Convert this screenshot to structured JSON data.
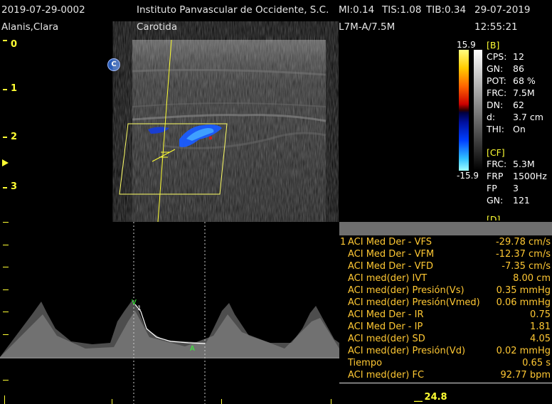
{
  "header": {
    "study_id": "2019-07-29-0002",
    "institution": "Instituto Panvascular de Occidente, S.C.",
    "mi": "MI:0.14",
    "tis": "TIS:1.08",
    "tib": "TIB:0.34",
    "date": "29-07-2019",
    "patient": "Alanis,Clara",
    "exam": "Carotida",
    "probe": "L7M-A/7.5M",
    "time": "12:55:21"
  },
  "depth_scale": [
    "0",
    "1",
    "2",
    "3"
  ],
  "colorbar": {
    "max": "15.9",
    "min": "-15.9"
  },
  "b_mode": {
    "title": "[B]",
    "params": [
      {
        "key": "CPS:",
        "value": "12"
      },
      {
        "key": "GN:",
        "value": "86"
      },
      {
        "key": "POT:",
        "value": "68 %"
      },
      {
        "key": "FRC:",
        "value": "7.5M"
      },
      {
        "key": "DN:",
        "value": "62"
      },
      {
        "key": "d:",
        "value": "3.7 cm"
      },
      {
        "key": "THI:",
        "value": "On"
      }
    ]
  },
  "cf_mode": {
    "title": "[CF]",
    "params": [
      {
        "key": "FRC:",
        "value": "5.3M"
      },
      {
        "key": "FRP",
        "value": "1500Hz"
      },
      {
        "key": "FP",
        "value": "3"
      },
      {
        "key": "GN:",
        "value": "121"
      }
    ],
    "next_section": "[D]"
  },
  "measurements": {
    "index": "1",
    "rows": [
      {
        "label": "ACI Med Der - VFS",
        "value": "-29.78 cm/s"
      },
      {
        "label": "ACI Med Der - VFM",
        "value": "-12.37 cm/s"
      },
      {
        "label": "ACI Med Der - VFD",
        "value": "-7.35 cm/s"
      },
      {
        "label": "ACI med(der) IVT",
        "value": "8.00 cm"
      },
      {
        "label": "ACI med(der) Presión(Vs)",
        "value": "0.35 mmHg"
      },
      {
        "label": "ACI med(der) Presión(Vmed)",
        "value": "0.06 mmHg"
      },
      {
        "label": "ACI Med Der - IR",
        "value": "0.75"
      },
      {
        "label": "ACI Med Der - IP",
        "value": "1.81"
      },
      {
        "label": "ACI med(der) SD",
        "value": "4.05"
      },
      {
        "label": "ACI med(der) Presión(Vd)",
        "value": "0.02 mmHg"
      },
      {
        "label": "Tiempo",
        "value": "0.65 s"
      },
      {
        "label": "ACI med(der) FC",
        "value": "92.77 bpm"
      }
    ]
  },
  "doppler": {
    "sweep_speed": "24.8",
    "peak_marker": "1",
    "colors": {
      "label": "#ffc833",
      "scale": "#ffff33",
      "flow_blue": "#1a5cff",
      "caliper": "#33ff33"
    }
  },
  "icons": {
    "color_mode_badge": "C"
  }
}
